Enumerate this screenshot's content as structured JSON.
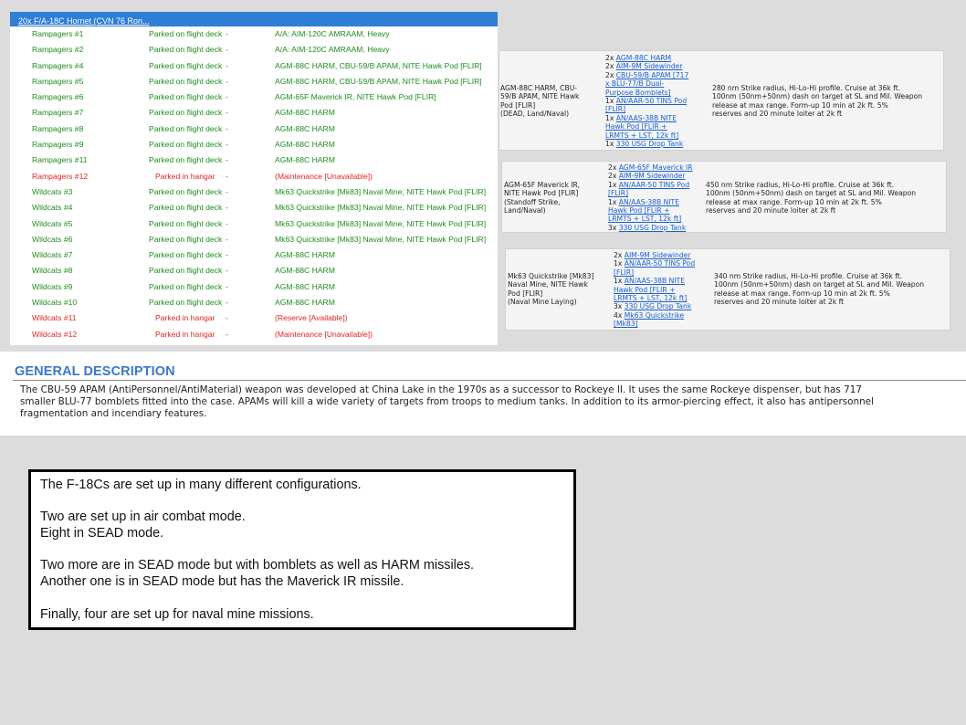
{
  "aircraft_list": {
    "header": "20x F/A-18C Hornet (CVN 76 Ron...",
    "rows": [
      {
        "name": "Rampagers #1",
        "status": "Parked on flight deck",
        "dash": "-",
        "loadout": "A/A: AIM-120C AMRAAM, Heavy",
        "state": "ok"
      },
      {
        "name": "Rampagers #2",
        "status": "Parked on flight deck",
        "dash": "-",
        "loadout": "A/A: AIM-120C AMRAAM, Heavy",
        "state": "ok"
      },
      {
        "name": "Rampagers #4",
        "status": "Parked on flight deck",
        "dash": "-",
        "loadout": "AGM-88C HARM, CBU-59/B APAM, NITE Hawk Pod [FLIR]",
        "state": "ok"
      },
      {
        "name": "Rampagers #5",
        "status": "Parked on flight deck",
        "dash": "-",
        "loadout": "AGM-88C HARM, CBU-59/B APAM, NITE Hawk Pod [FLIR]",
        "state": "ok"
      },
      {
        "name": "Rampagers #6",
        "status": "Parked on flight deck",
        "dash": "-",
        "loadout": "AGM-65F Maverick IR, NITE Hawk Pod [FLIR]",
        "state": "ok"
      },
      {
        "name": "Rampagers #7",
        "status": "Parked on flight deck",
        "dash": "-",
        "loadout": "AGM-88C HARM",
        "state": "ok"
      },
      {
        "name": "Rampagers #8",
        "status": "Parked on flight deck",
        "dash": "-",
        "loadout": "AGM-88C HARM",
        "state": "ok"
      },
      {
        "name": "Rampagers #9",
        "status": "Parked on flight deck",
        "dash": "-",
        "loadout": "AGM-88C HARM",
        "state": "ok"
      },
      {
        "name": "Rampagers #11",
        "status": "Parked on flight deck",
        "dash": "-",
        "loadout": "AGM-88C HARM",
        "state": "ok"
      },
      {
        "name": "Rampagers #12",
        "status": "Parked in hangar",
        "dash": "-",
        "loadout": "(Maintenance [Unavailable])",
        "state": "bad"
      },
      {
        "name": "Wildcats #3",
        "status": "Parked on flight deck",
        "dash": "-",
        "loadout": "Mk63 Quickstrike [Mk83] Naval Mine, NITE Hawk Pod [FLIR]",
        "state": "ok"
      },
      {
        "name": "Wildcats #4",
        "status": "Parked on flight deck",
        "dash": "-",
        "loadout": "Mk63 Quickstrike [Mk83] Naval Mine, NITE Hawk Pod [FLIR]",
        "state": "ok"
      },
      {
        "name": "Wildcats #5",
        "status": "Parked on flight deck",
        "dash": "-",
        "loadout": "Mk63 Quickstrike [Mk83] Naval Mine, NITE Hawk Pod [FLIR]",
        "state": "ok"
      },
      {
        "name": "Wildcats #6",
        "status": "Parked on flight deck",
        "dash": "-",
        "loadout": "Mk63 Quickstrike [Mk83] Naval Mine, NITE Hawk Pod [FLIR]",
        "state": "ok"
      },
      {
        "name": "Wildcats #7",
        "status": "Parked on flight deck",
        "dash": "-",
        "loadout": "AGM-88C HARM",
        "state": "ok"
      },
      {
        "name": "Wildcats #8",
        "status": "Parked on flight deck",
        "dash": "-",
        "loadout": "AGM-88C HARM",
        "state": "ok"
      },
      {
        "name": "Wildcats #9",
        "status": "Parked on flight deck",
        "dash": "-",
        "loadout": "AGM-88C HARM",
        "state": "ok"
      },
      {
        "name": "Wildcats #10",
        "status": "Parked on flight deck",
        "dash": "-",
        "loadout": "AGM-88C HARM",
        "state": "ok"
      },
      {
        "name": "Wildcats #11",
        "status": "Parked in hangar",
        "dash": "-",
        "loadout": "(Reserve [Available])",
        "state": "bad"
      },
      {
        "name": "Wildcats #12",
        "status": "Parked in hangar",
        "dash": "-",
        "loadout": "(Maintenance [Unavailable])",
        "state": "bad"
      }
    ]
  },
  "colors": {
    "ok": "#1e8c1e",
    "bad": "#e02424",
    "header_bg": "#2f7fd6",
    "link": "#1a5fd0",
    "section_title": "#3b78c8"
  },
  "loadout_cards": [
    {
      "loadout_lines": [
        "AGM-88C HARM, CBU-",
        "59/B APAM, NITE Hawk",
        "Pod [FLIR]",
        "(DEAD, Land/Naval)"
      ],
      "weapons": [
        {
          "qty": "2x",
          "lines": [
            "AGM-88C HARM"
          ]
        },
        {
          "qty": "2x",
          "lines": [
            "AIM-9M Sidewinder"
          ]
        },
        {
          "qty": "2x",
          "lines": [
            "CBU-59/B APAM [717",
            "x BLU-77/B Dual-",
            "Purpose Bomblets]"
          ]
        },
        {
          "qty": "1x",
          "lines": [
            "AN/AAR-50 TINS Pod",
            "[FLIR]"
          ]
        },
        {
          "qty": "1x",
          "lines": [
            "AN/AAS-38B NITE",
            "Hawk Pod [FLIR +",
            "LRMTS + LST, 12k ft]"
          ]
        },
        {
          "qty": "1x",
          "lines": [
            "330 USG Drop Tank"
          ]
        }
      ],
      "description_lines": [
        "280 nm Strike radius, Hi-Lo-Hi profile. Cruise at 36k ft.",
        "100nm (50nm+50nm) dash on target at SL and Mil. Weapon",
        "release at max range. Form-up 10 min at 2k ft. 5%",
        "reserves and 20 minute loiter at 2k ft"
      ]
    },
    {
      "loadout_lines": [
        "AGM-65F Maverick IR,",
        "NITE Hawk Pod [FLIR]",
        "(Standoff Strike,",
        "Land/Naval)"
      ],
      "weapons": [
        {
          "qty": "2x",
          "lines": [
            "AGM-65F Maverick IR"
          ]
        },
        {
          "qty": "2x",
          "lines": [
            "AIM-9M Sidewinder"
          ]
        },
        {
          "qty": "1x",
          "lines": [
            "AN/AAR-50 TINS Pod",
            "[FLIR]"
          ]
        },
        {
          "qty": "1x",
          "lines": [
            "AN/AAS-38B NITE",
            "Hawk Pod [FLIR +",
            "LRMTS + LST, 12k ft]"
          ]
        },
        {
          "qty": "3x",
          "lines": [
            "330 USG Drop Tank"
          ]
        }
      ],
      "description_lines": [
        "450 nm Strike radius, Hi-Lo-Hi profile. Cruise at 36k ft.",
        "100nm (50nm+50nm) dash on target at SL and Mil. Weapon",
        "release at max range. Form-up 10 min at 2k ft. 5%",
        "reserves and 20 minute loiter at 2k ft"
      ]
    },
    {
      "loadout_lines": [
        "Mk63 Quickstrike [Mk83]",
        "Naval Mine, NITE Hawk",
        "Pod [FLIR]",
        "(Naval Mine Laying)"
      ],
      "weapons": [
        {
          "qty": "2x",
          "lines": [
            "AIM-9M Sidewinder"
          ]
        },
        {
          "qty": "1x",
          "lines": [
            "AN/AAR-50 TINS Pod",
            "[FLIR]"
          ]
        },
        {
          "qty": "1x",
          "lines": [
            "AN/AAS-38B NITE",
            "Hawk Pod [FLIR +",
            "LRMTS + LST, 12k ft]"
          ]
        },
        {
          "qty": "3x",
          "lines": [
            "330 USG Drop Tank"
          ]
        },
        {
          "qty": "4x",
          "lines": [
            "Mk63 Quickstrike",
            "[Mk83]"
          ]
        }
      ],
      "description_lines": [
        "340 nm Strike radius, Hi-Lo-Hi profile. Cruise at 36k ft.",
        "100nm (50nm+50nm) dash on target at SL and Mil. Weapon",
        "release at max range. Form-up 10 min at 2k ft. 5%",
        "reserves and 20 minute loiter at 2k ft"
      ]
    }
  ],
  "general_description": {
    "title": "GENERAL DESCRIPTION",
    "body_lines": [
      "The CBU-59 APAM (AntiPersonnel/AntiMaterial) weapon was developed at China Lake in the 1970s as a successor to Rockeye II. It uses the same Rockeye dispenser, but has 717",
      "smaller BLU-77 bomblets fitted into the case. APAMs will kill a wide variety of targets from troops to medium tanks. In addition to its armor-piercing effect, it also has antipersonnel",
      "fragmentation and incendiary features."
    ]
  },
  "note": {
    "lines": [
      "The F-18Cs are set up in many different configurations.",
      "",
      "Two are set up in air combat mode.",
      "Eight in SEAD mode.",
      "",
      "Two more are in SEAD mode but with bomblets as well as HARM missiles.",
      "Another one is in SEAD mode but has the Maverick IR missile.",
      "",
      "Finally, four are set up for naval mine missions."
    ]
  }
}
